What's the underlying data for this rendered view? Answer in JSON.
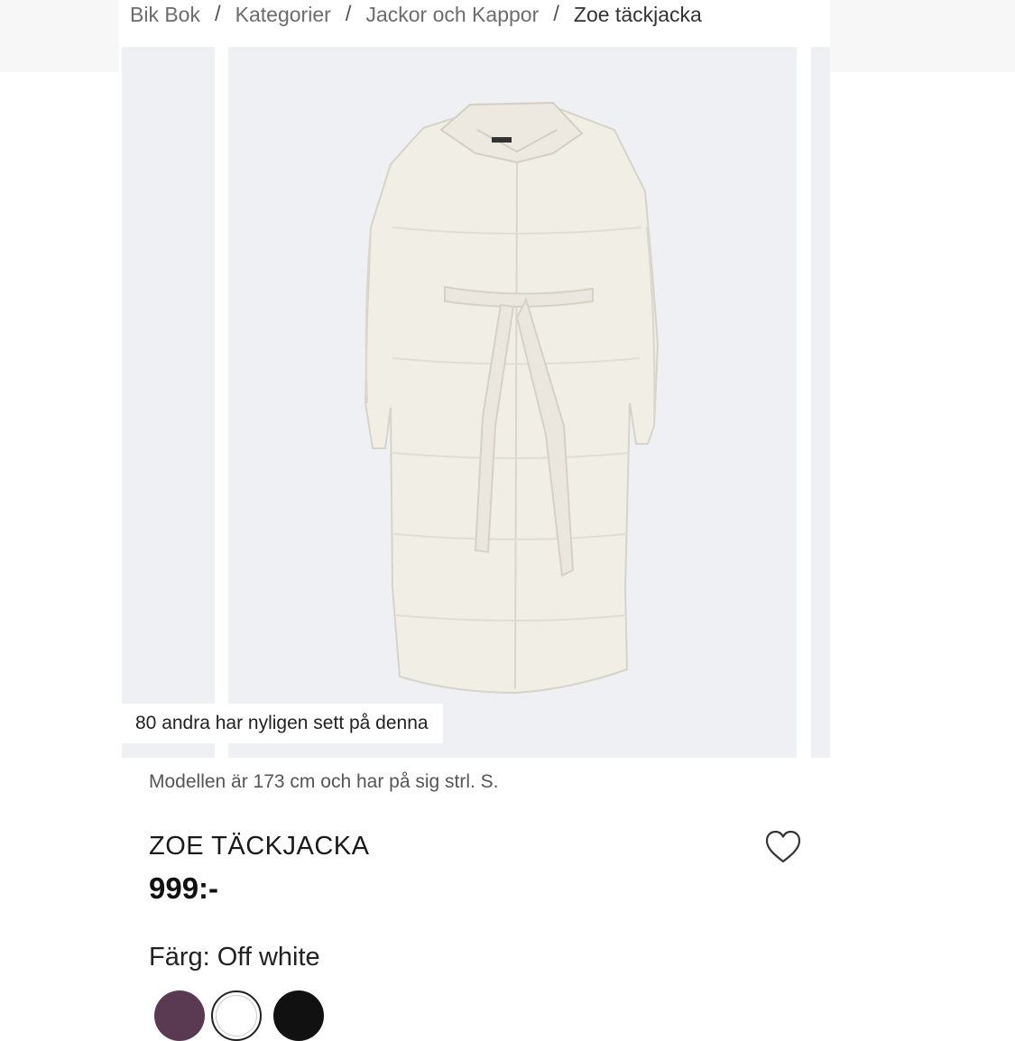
{
  "breadcrumb": {
    "items": [
      "Bik Bok",
      "Kategorier",
      "Jackor och Kappor"
    ],
    "separator": "/",
    "current": "Zoe täckjacka"
  },
  "gallery": {
    "recently_viewed": "80 andra har nyligen sett på denna"
  },
  "product": {
    "model_info": "Modellen är 173 cm och har på sig strl. S.",
    "title": "ZOE TÄCKJACKA",
    "price": "999:-",
    "color_label": "Färg: Off white",
    "swatches": [
      {
        "name": "purple",
        "color": "#5a3a52"
      },
      {
        "name": "off-white",
        "color": "#ffffff",
        "selected": true
      },
      {
        "name": "black",
        "color": "#111111"
      }
    ]
  },
  "icons": {
    "favorite": "heart-icon"
  }
}
